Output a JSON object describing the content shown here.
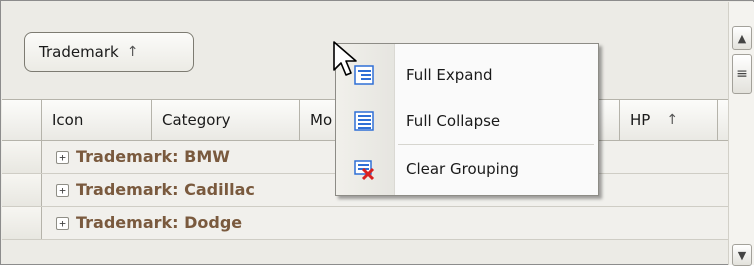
{
  "group_panel": {
    "chip_label": "Trademark",
    "chip_sort_icon": "sort-ascending-icon"
  },
  "grid": {
    "columns": [
      {
        "label": ""
      },
      {
        "label": "Icon"
      },
      {
        "label": "Category"
      },
      {
        "label": "Mo"
      },
      {
        "label": ""
      },
      {
        "label": "HP",
        "sort": "ascending"
      },
      {
        "label": ""
      }
    ],
    "group_rows": [
      {
        "label": "Trademark: BMW"
      },
      {
        "label": "Trademark: Cadillac"
      },
      {
        "label": "Trademark: Dodge"
      }
    ],
    "expander_glyph": "+"
  },
  "context_menu": {
    "items": [
      {
        "label": "Full Expand",
        "icon": "full-expand-icon"
      },
      {
        "label": "Full Collapse",
        "icon": "full-collapse-icon"
      },
      {
        "label": "Clear Grouping",
        "icon": "clear-grouping-icon"
      }
    ]
  },
  "scrollbar": {
    "up_glyph": "^",
    "thumb_glyph": "≡",
    "down_glyph": "v"
  },
  "colors": {
    "group_text": "#7a5a3e",
    "panel_background": "#ecebe6",
    "menu_icon_blue": "#2f6fd6",
    "clear_icon_red": "#d92020"
  }
}
